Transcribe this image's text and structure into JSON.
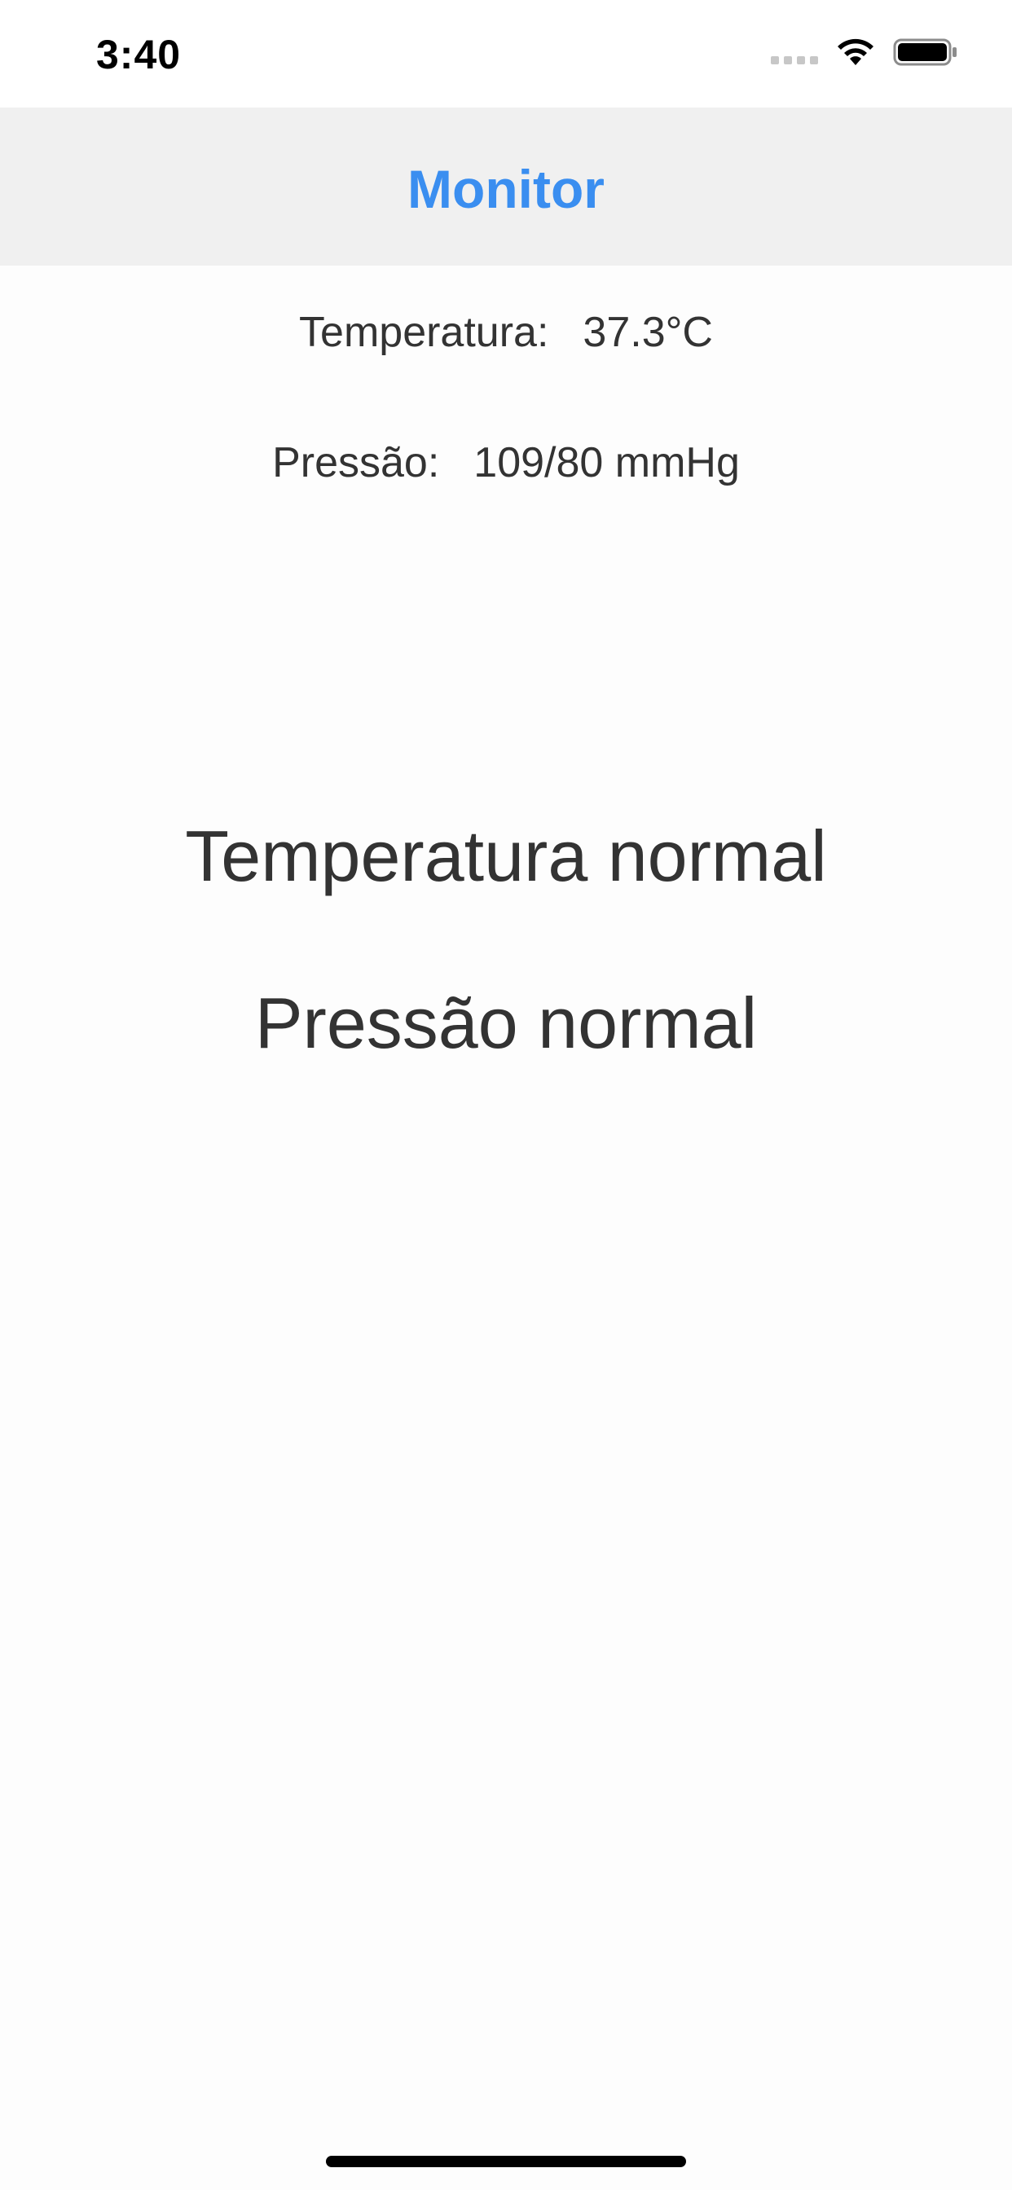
{
  "status_bar": {
    "time": "3:40",
    "signal_icon": "cellular-signal-icon",
    "wifi_icon": "wifi-icon",
    "battery_icon": "battery-icon"
  },
  "nav": {
    "title": "Monitor"
  },
  "readings": {
    "temperature_label": "Temperatura:",
    "temperature_value": "37.3°C",
    "pressure_label": "Pressão:",
    "pressure_value": "109/80 mmHg"
  },
  "status": {
    "temperature": "Temperatura normal",
    "pressure": "Pressão normal"
  },
  "colors": {
    "accent": "#3a8ef0",
    "nav_background": "#f0f0f0",
    "text": "#333333"
  }
}
